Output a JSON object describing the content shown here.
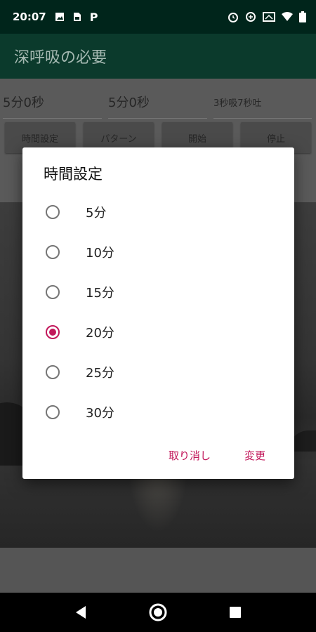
{
  "status_bar": {
    "time": "20:07",
    "left_icons": [
      "image-icon",
      "sim-icon",
      "p-icon"
    ],
    "right_icons": [
      "alarm-icon",
      "data-saver-icon",
      "cast-icon",
      "wifi-icon",
      "battery-icon"
    ]
  },
  "app_bar": {
    "title": "深呼吸の必要"
  },
  "fields": {
    "time1": "5分0秒",
    "time2": "5分0秒",
    "pattern": "3秒吸7秒吐"
  },
  "buttons": {
    "time_setting": "時間設定",
    "pattern": "パターン",
    "start": "開始",
    "stop": "停止"
  },
  "dialog": {
    "title": "時間設定",
    "options": [
      {
        "label": "5分",
        "selected": false
      },
      {
        "label": "10分",
        "selected": false
      },
      {
        "label": "15分",
        "selected": false
      },
      {
        "label": "20分",
        "selected": true
      },
      {
        "label": "25分",
        "selected": false
      },
      {
        "label": "30分",
        "selected": false
      }
    ],
    "cancel": "取り消し",
    "confirm": "変更"
  },
  "colors": {
    "accent": "#c2185b",
    "primary_dark": "#00251b",
    "primary": "#0b3a2c"
  }
}
